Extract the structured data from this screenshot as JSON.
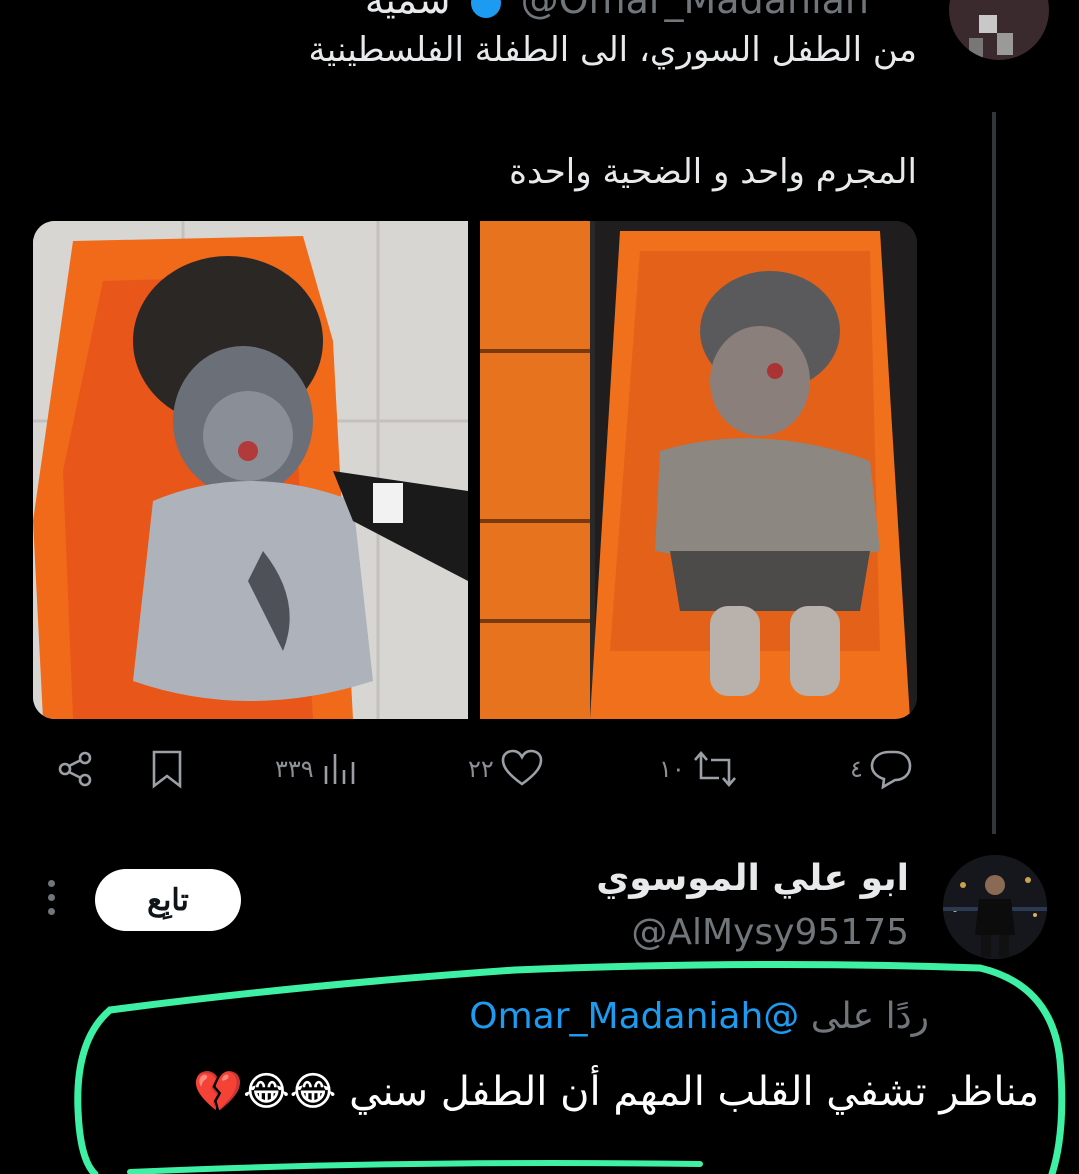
{
  "original_tweet": {
    "display_name": "سمية",
    "handle": "@Omar_Madaniah",
    "time_fragment": "·",
    "text_line_1": "من الطفل السوري، الى الطفلة الفلسطينية",
    "text_line_2": "المجرم واحد و الضحية واحدة",
    "media": {
      "panels": [
        "injured-child-on-stretcher-photo",
        "injured-child-in-ambulance-seat-photo"
      ]
    },
    "actions": {
      "reply_count": "٤",
      "retweet_count": "١٠",
      "like_count": "٢٢",
      "view_count": "٣٣٩"
    }
  },
  "reply": {
    "display_name": "ابو علي الموسوي",
    "handle": "@AlMysy95175",
    "follow_label": "تابِع",
    "replying_to_prefix": "ردًا على",
    "replying_to_handle": "@Omar_Madaniah",
    "text": "مناظر تشفي القلب المهم أن الطفل سني 😂😂💔"
  },
  "colors": {
    "background": "#000000",
    "text": "#e7e9ea",
    "muted": "#71767b",
    "link": "#1d9bf0",
    "highlight_marker": "#3ef0a4"
  }
}
